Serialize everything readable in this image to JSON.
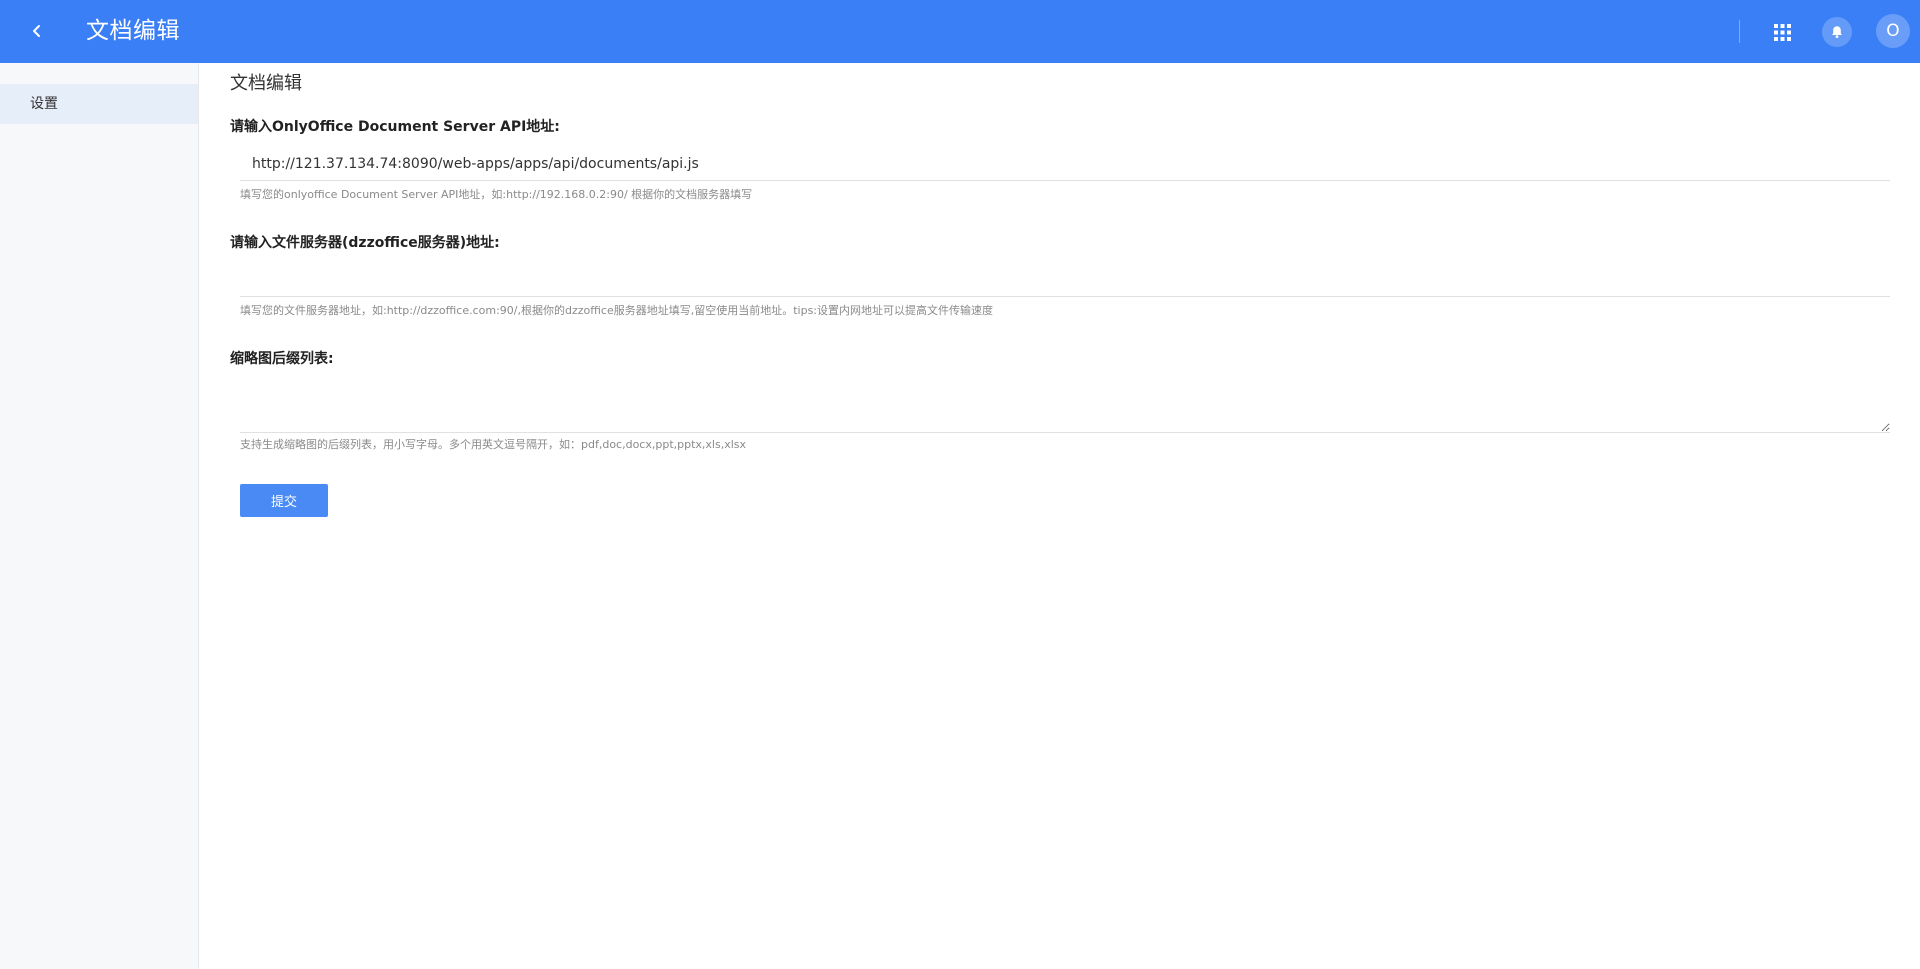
{
  "header": {
    "title": "文档编辑",
    "avatar_initial": "O",
    "accent_color": "#3a7ff6"
  },
  "sidebar": {
    "items": [
      {
        "label": "设置",
        "active": true
      }
    ]
  },
  "main": {
    "page_title": "文档编辑",
    "fields": [
      {
        "label": "请输入OnlyOffice Document Server API地址:",
        "value": "http://121.37.134.74:8090/web-apps/apps/api/documents/api.js",
        "help": "填写您的onlyoffice Document Server API地址，如:http://192.168.0.2:90/ 根据你的文档服务器填写"
      },
      {
        "label": "请输入文件服务器(dzzoffice服务器)地址:",
        "value": "",
        "help": "填写您的文件服务器地址，如:http://dzzoffice.com:90/,根据你的dzzoffice服务器地址填写,留空使用当前地址。tips:设置内网地址可以提高文件传输速度"
      },
      {
        "label": "缩略图后缀列表:",
        "value": "",
        "help": "支持生成缩略图的后缀列表，用小写字母。多个用英文逗号隔开，如：pdf,doc,docx,ppt,pptx,xls,xlsx"
      }
    ],
    "submit_label": "提交"
  }
}
